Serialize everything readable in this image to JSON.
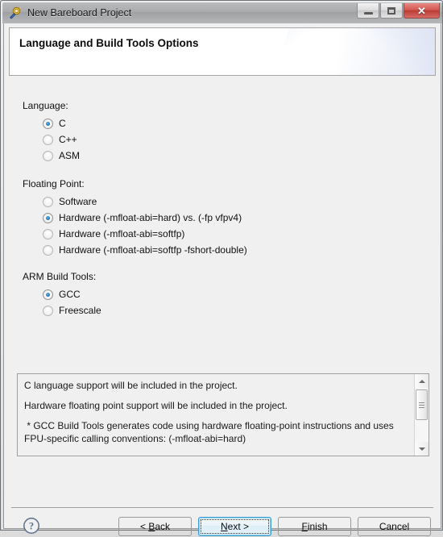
{
  "window": {
    "title": "New Bareboard Project",
    "icon": "wizard-wand-icon",
    "controls": {
      "minimize": "Minimize",
      "restore": "Restore",
      "close": "✕"
    }
  },
  "header": {
    "title": "Language and Build Tools Options"
  },
  "sections": [
    {
      "key": "language",
      "label": "Language:",
      "options": [
        {
          "label": "C",
          "selected": true
        },
        {
          "label": "C++",
          "selected": false
        },
        {
          "label": "ASM",
          "selected": false
        }
      ]
    },
    {
      "key": "floating_point",
      "label": "Floating Point:",
      "options": [
        {
          "label": "Software",
          "selected": false
        },
        {
          "label": "Hardware (-mfloat-abi=hard) vs. (-fp vfpv4)",
          "selected": true
        },
        {
          "label": "Hardware (-mfloat-abi=softfp)",
          "selected": false
        },
        {
          "label": "Hardware (-mfloat-abi=softfp -fshort-double)",
          "selected": false
        }
      ]
    },
    {
      "key": "arm_build_tools",
      "label": "ARM Build Tools:",
      "options": [
        {
          "label": "GCC",
          "selected": true
        },
        {
          "label": "Freescale",
          "selected": false
        }
      ]
    }
  ],
  "description": {
    "lines": [
      "C language support will be included in the project.",
      "",
      "Hardware floating point support will be included in the project.",
      "",
      " * GCC Build Tools generates code using hardware floating-point instructions and uses",
      "FPU-specific calling conventions: (-mfloat-abi=hard)"
    ],
    "scrollbar": {
      "up_arrow": "scroll-up-arrow",
      "down_arrow": "scroll-down-arrow"
    }
  },
  "footer": {
    "help": "?",
    "buttons": [
      {
        "key": "back",
        "label": "< Back",
        "mnemonic": "B",
        "focused": false
      },
      {
        "key": "next",
        "label": "Next >",
        "mnemonic": "N",
        "focused": true
      },
      {
        "key": "finish",
        "label": "Finish",
        "mnemonic": "F",
        "focused": false
      },
      {
        "key": "cancel",
        "label": "Cancel",
        "mnemonic": "",
        "focused": false
      }
    ]
  },
  "colors": {
    "accent_blue": "#1a6fb5",
    "focus_border": "#3c9fd4",
    "close_red": "#c2433c",
    "body_bg": "#f0f0f0"
  }
}
